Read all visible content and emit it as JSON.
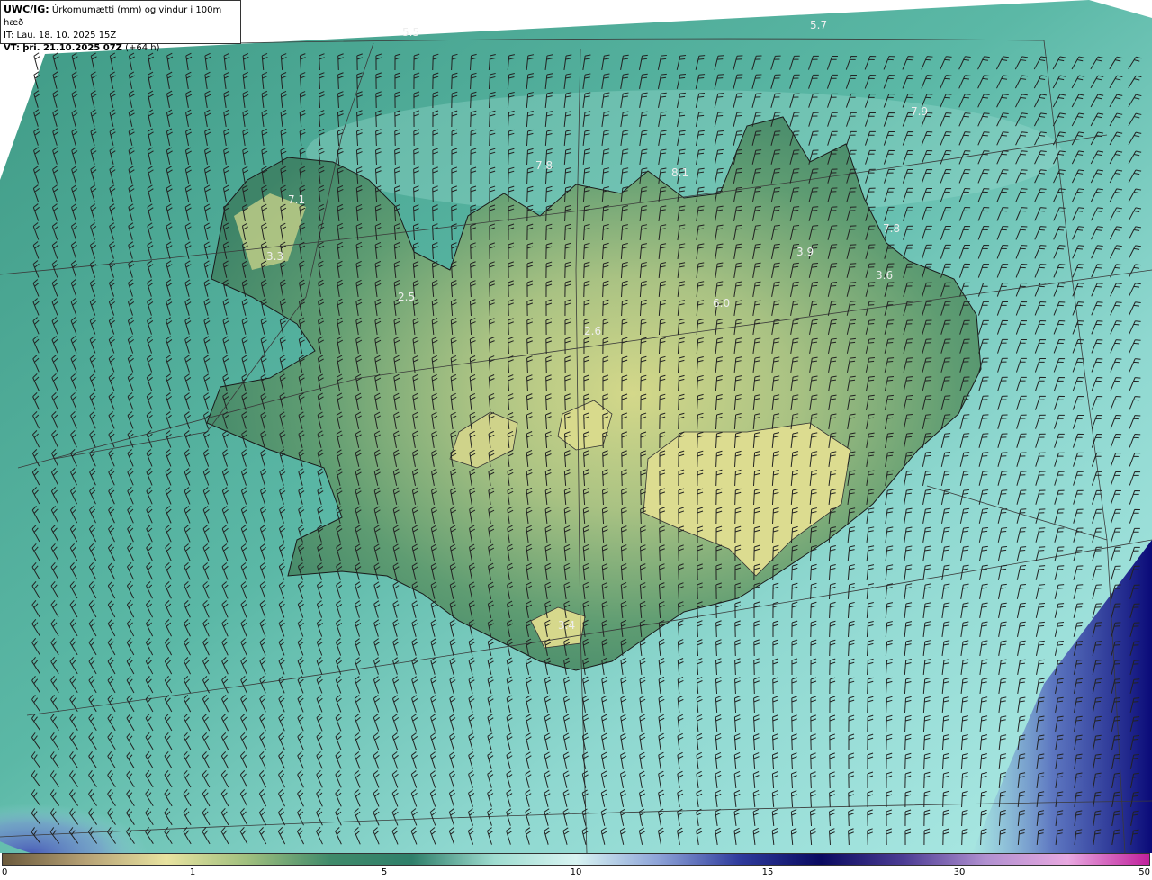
{
  "header": {
    "product": "UWC/IG:",
    "description": "Úrkomumætti (mm) og vindur i 100m hæð",
    "init_time": "IT: Lau. 18. 10. 2025 15Z",
    "valid_label": "VT:",
    "valid_time": "þri. 21.10.2025 07Z",
    "lead": "(+64 h)"
  },
  "map_labels": [
    "5.5",
    "5.7",
    "7.9",
    "7.8",
    "8.1",
    "7.1",
    "3.3",
    "2.5",
    "3.9",
    "7.8",
    "3.6",
    "6.0",
    "2.6",
    "3.4"
  ],
  "colorbar": {
    "ticks": [
      "0",
      "1",
      "5",
      "10",
      "15",
      "30",
      "50"
    ],
    "colors": [
      "#6b5a3c",
      "#b5a074",
      "#e8e3a0",
      "#9fbf7e",
      "#3f8a6a",
      "#2f7f6a",
      "#9fdcd0",
      "#d8f4f2",
      "#8ea4d8",
      "#2e3a9c",
      "#0a0a60",
      "#4c3c94",
      "#b090d0",
      "#e8a8e0",
      "#c0209c"
    ]
  }
}
